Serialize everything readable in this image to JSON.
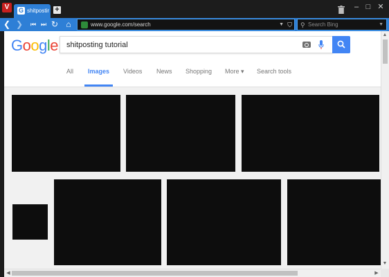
{
  "browser": {
    "tab_title": "shitposting t",
    "tab_favicon": "G",
    "logo_glyph": "V",
    "new_tab_glyph": "+",
    "url": "www.google.com/search",
    "search_placeholder": "Search Bing",
    "accent_color": "#2e7fd6"
  },
  "google": {
    "logo_letters": [
      "G",
      "o",
      "o",
      "g",
      "l",
      "e"
    ],
    "logo_colors": [
      "#4285f4",
      "#ea4335",
      "#fbbc05",
      "#4285f4",
      "#34a853",
      "#ea4335"
    ],
    "query": "shitposting tutorial",
    "tabs": [
      {
        "label": "All",
        "active": false
      },
      {
        "label": "Images",
        "active": true
      },
      {
        "label": "Videos",
        "active": false
      },
      {
        "label": "News",
        "active": false
      },
      {
        "label": "Shopping",
        "active": false
      },
      {
        "label": "More ▾",
        "active": false
      },
      {
        "label": "Search tools",
        "active": false
      }
    ]
  },
  "icons": [
    "vivaldi-logo-icon",
    "google-favicon-icon",
    "new-tab-icon",
    "trash-icon",
    "minimize-icon",
    "maximize-icon",
    "close-icon",
    "back-icon",
    "forward-icon",
    "rewind-icon",
    "fast-forward-icon",
    "reload-icon",
    "home-icon",
    "lock-icon",
    "bookmark-icon",
    "search-engine-icon",
    "camera-icon",
    "microphone-icon",
    "magnifier-icon"
  ]
}
